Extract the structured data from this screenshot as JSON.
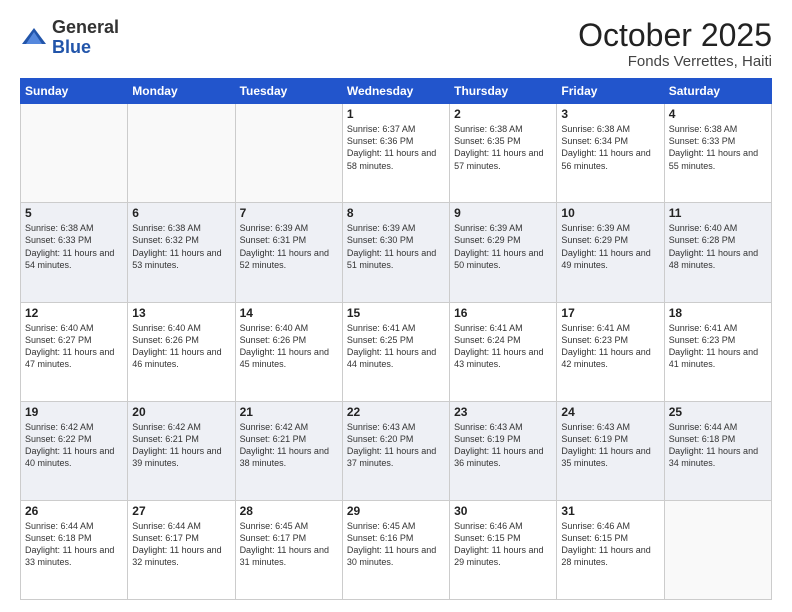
{
  "header": {
    "logo_general": "General",
    "logo_blue": "Blue",
    "month": "October 2025",
    "location": "Fonds Verrettes, Haiti"
  },
  "days_of_week": [
    "Sunday",
    "Monday",
    "Tuesday",
    "Wednesday",
    "Thursday",
    "Friday",
    "Saturday"
  ],
  "weeks": [
    [
      {
        "day": "",
        "sunrise": "",
        "sunset": "",
        "daylight": ""
      },
      {
        "day": "",
        "sunrise": "",
        "sunset": "",
        "daylight": ""
      },
      {
        "day": "",
        "sunrise": "",
        "sunset": "",
        "daylight": ""
      },
      {
        "day": "1",
        "sunrise": "Sunrise: 6:37 AM",
        "sunset": "Sunset: 6:36 PM",
        "daylight": "Daylight: 11 hours and 58 minutes."
      },
      {
        "day": "2",
        "sunrise": "Sunrise: 6:38 AM",
        "sunset": "Sunset: 6:35 PM",
        "daylight": "Daylight: 11 hours and 57 minutes."
      },
      {
        "day": "3",
        "sunrise": "Sunrise: 6:38 AM",
        "sunset": "Sunset: 6:34 PM",
        "daylight": "Daylight: 11 hours and 56 minutes."
      },
      {
        "day": "4",
        "sunrise": "Sunrise: 6:38 AM",
        "sunset": "Sunset: 6:33 PM",
        "daylight": "Daylight: 11 hours and 55 minutes."
      }
    ],
    [
      {
        "day": "5",
        "sunrise": "Sunrise: 6:38 AM",
        "sunset": "Sunset: 6:33 PM",
        "daylight": "Daylight: 11 hours and 54 minutes."
      },
      {
        "day": "6",
        "sunrise": "Sunrise: 6:38 AM",
        "sunset": "Sunset: 6:32 PM",
        "daylight": "Daylight: 11 hours and 53 minutes."
      },
      {
        "day": "7",
        "sunrise": "Sunrise: 6:39 AM",
        "sunset": "Sunset: 6:31 PM",
        "daylight": "Daylight: 11 hours and 52 minutes."
      },
      {
        "day": "8",
        "sunrise": "Sunrise: 6:39 AM",
        "sunset": "Sunset: 6:30 PM",
        "daylight": "Daylight: 11 hours and 51 minutes."
      },
      {
        "day": "9",
        "sunrise": "Sunrise: 6:39 AM",
        "sunset": "Sunset: 6:29 PM",
        "daylight": "Daylight: 11 hours and 50 minutes."
      },
      {
        "day": "10",
        "sunrise": "Sunrise: 6:39 AM",
        "sunset": "Sunset: 6:29 PM",
        "daylight": "Daylight: 11 hours and 49 minutes."
      },
      {
        "day": "11",
        "sunrise": "Sunrise: 6:40 AM",
        "sunset": "Sunset: 6:28 PM",
        "daylight": "Daylight: 11 hours and 48 minutes."
      }
    ],
    [
      {
        "day": "12",
        "sunrise": "Sunrise: 6:40 AM",
        "sunset": "Sunset: 6:27 PM",
        "daylight": "Daylight: 11 hours and 47 minutes."
      },
      {
        "day": "13",
        "sunrise": "Sunrise: 6:40 AM",
        "sunset": "Sunset: 6:26 PM",
        "daylight": "Daylight: 11 hours and 46 minutes."
      },
      {
        "day": "14",
        "sunrise": "Sunrise: 6:40 AM",
        "sunset": "Sunset: 6:26 PM",
        "daylight": "Daylight: 11 hours and 45 minutes."
      },
      {
        "day": "15",
        "sunrise": "Sunrise: 6:41 AM",
        "sunset": "Sunset: 6:25 PM",
        "daylight": "Daylight: 11 hours and 44 minutes."
      },
      {
        "day": "16",
        "sunrise": "Sunrise: 6:41 AM",
        "sunset": "Sunset: 6:24 PM",
        "daylight": "Daylight: 11 hours and 43 minutes."
      },
      {
        "day": "17",
        "sunrise": "Sunrise: 6:41 AM",
        "sunset": "Sunset: 6:23 PM",
        "daylight": "Daylight: 11 hours and 42 minutes."
      },
      {
        "day": "18",
        "sunrise": "Sunrise: 6:41 AM",
        "sunset": "Sunset: 6:23 PM",
        "daylight": "Daylight: 11 hours and 41 minutes."
      }
    ],
    [
      {
        "day": "19",
        "sunrise": "Sunrise: 6:42 AM",
        "sunset": "Sunset: 6:22 PM",
        "daylight": "Daylight: 11 hours and 40 minutes."
      },
      {
        "day": "20",
        "sunrise": "Sunrise: 6:42 AM",
        "sunset": "Sunset: 6:21 PM",
        "daylight": "Daylight: 11 hours and 39 minutes."
      },
      {
        "day": "21",
        "sunrise": "Sunrise: 6:42 AM",
        "sunset": "Sunset: 6:21 PM",
        "daylight": "Daylight: 11 hours and 38 minutes."
      },
      {
        "day": "22",
        "sunrise": "Sunrise: 6:43 AM",
        "sunset": "Sunset: 6:20 PM",
        "daylight": "Daylight: 11 hours and 37 minutes."
      },
      {
        "day": "23",
        "sunrise": "Sunrise: 6:43 AM",
        "sunset": "Sunset: 6:19 PM",
        "daylight": "Daylight: 11 hours and 36 minutes."
      },
      {
        "day": "24",
        "sunrise": "Sunrise: 6:43 AM",
        "sunset": "Sunset: 6:19 PM",
        "daylight": "Daylight: 11 hours and 35 minutes."
      },
      {
        "day": "25",
        "sunrise": "Sunrise: 6:44 AM",
        "sunset": "Sunset: 6:18 PM",
        "daylight": "Daylight: 11 hours and 34 minutes."
      }
    ],
    [
      {
        "day": "26",
        "sunrise": "Sunrise: 6:44 AM",
        "sunset": "Sunset: 6:18 PM",
        "daylight": "Daylight: 11 hours and 33 minutes."
      },
      {
        "day": "27",
        "sunrise": "Sunrise: 6:44 AM",
        "sunset": "Sunset: 6:17 PM",
        "daylight": "Daylight: 11 hours and 32 minutes."
      },
      {
        "day": "28",
        "sunrise": "Sunrise: 6:45 AM",
        "sunset": "Sunset: 6:17 PM",
        "daylight": "Daylight: 11 hours and 31 minutes."
      },
      {
        "day": "29",
        "sunrise": "Sunrise: 6:45 AM",
        "sunset": "Sunset: 6:16 PM",
        "daylight": "Daylight: 11 hours and 30 minutes."
      },
      {
        "day": "30",
        "sunrise": "Sunrise: 6:46 AM",
        "sunset": "Sunset: 6:15 PM",
        "daylight": "Daylight: 11 hours and 29 minutes."
      },
      {
        "day": "31",
        "sunrise": "Sunrise: 6:46 AM",
        "sunset": "Sunset: 6:15 PM",
        "daylight": "Daylight: 11 hours and 28 minutes."
      },
      {
        "day": "",
        "sunrise": "",
        "sunset": "",
        "daylight": ""
      }
    ]
  ]
}
